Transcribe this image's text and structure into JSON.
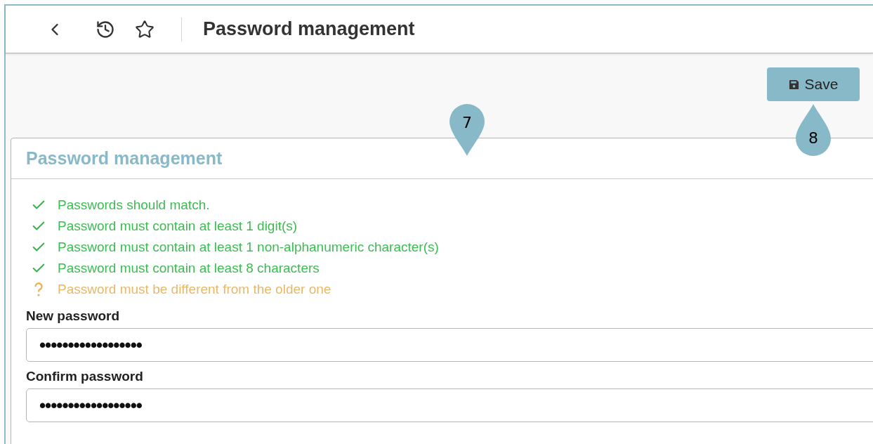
{
  "header": {
    "title": "Password management"
  },
  "toolbar": {
    "save_button": "Save"
  },
  "callouts": [
    {
      "number": "7",
      "kind": "down"
    },
    {
      "number": "8",
      "kind": "up"
    }
  ],
  "card": {
    "title": "Password management",
    "rules": [
      {
        "text": "Passwords should match.",
        "kind": "met"
      },
      {
        "text": "Password must contain at least 1 digit(s)",
        "kind": "met"
      },
      {
        "text": "Password must contain at least 1 non-alphanumeric character(s)",
        "kind": "met"
      },
      {
        "text": "Password must contain at least 8 characters",
        "kind": "met"
      },
      {
        "text": "Password must be different from the older one",
        "kind": "pending"
      }
    ],
    "fields": [
      {
        "label": "New password",
        "value": "••••••••••••••••••"
      },
      {
        "label": "Confirm password",
        "value": "••••••••••••••••••"
      }
    ]
  }
}
